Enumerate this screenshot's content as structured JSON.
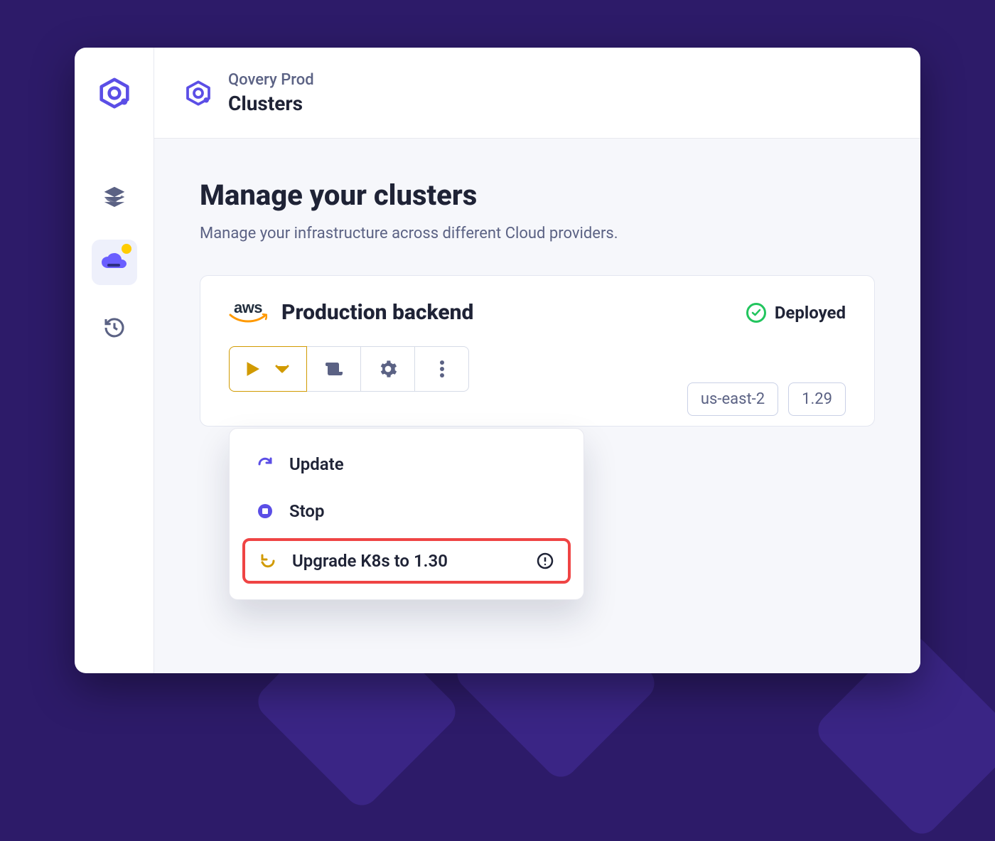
{
  "colors": {
    "accent": "#5b4ee6",
    "warning": "#d19a00",
    "success": "#22c55e",
    "danger": "#ef4444"
  },
  "header": {
    "org": "Qovery Prod",
    "page": "Clusters"
  },
  "page": {
    "title": "Manage your clusters",
    "subtitle": "Manage your infrastructure across different Cloud providers."
  },
  "cluster": {
    "provider": "aws",
    "name": "Production backend",
    "status_label": "Deployed",
    "chips": {
      "region": "us-east-2",
      "k8s_version": "1.29"
    }
  },
  "menu": {
    "update": "Update",
    "stop": "Stop",
    "upgrade": "Upgrade K8s to 1.30"
  },
  "sidebar": {
    "items": [
      "layers",
      "cloud",
      "history"
    ],
    "active": "cloud"
  }
}
